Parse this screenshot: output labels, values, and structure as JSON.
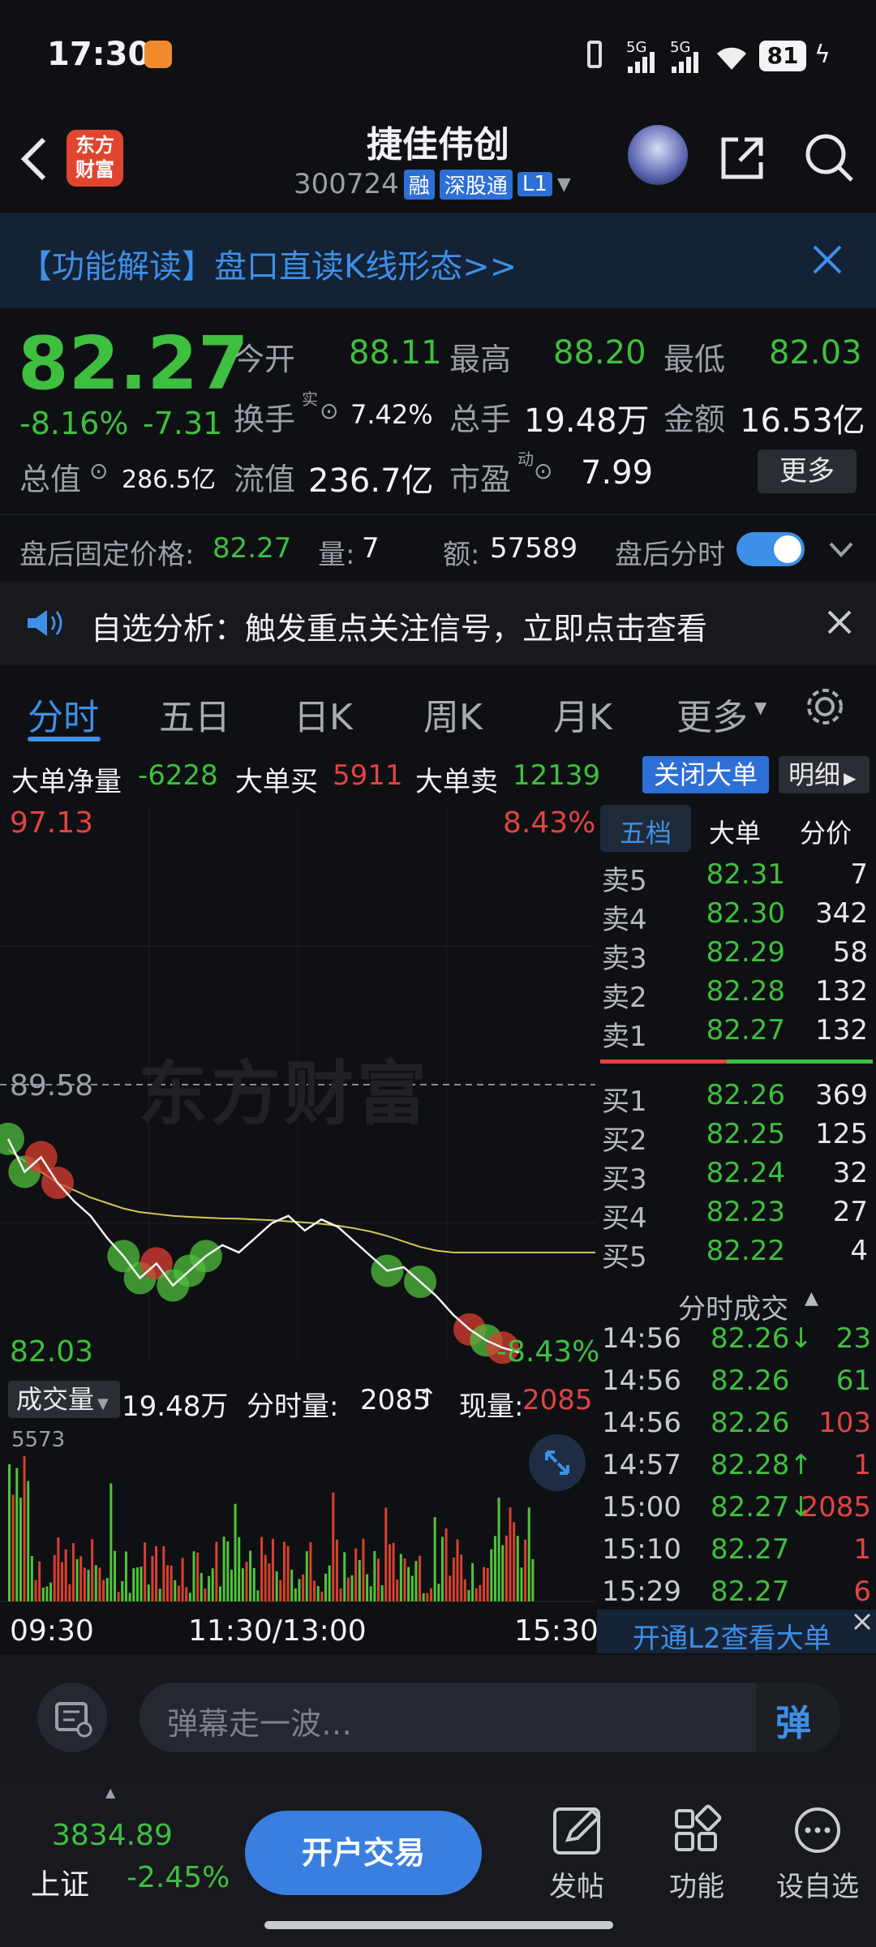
{
  "status": {
    "time": "17:30",
    "battery": "81",
    "network1": "5G",
    "network2": "5G"
  },
  "header": {
    "stock_name": "捷佳伟创",
    "code": "300724",
    "tags": [
      "融",
      "深股通",
      "L1"
    ],
    "logo_text": "东方财富"
  },
  "banner": {
    "text": "【功能解读】盘口直读K线形态>>"
  },
  "quote": {
    "price": "82.27",
    "change_pct": "-8.16%",
    "change": "-7.31",
    "open_label": "今开",
    "open": "88.11",
    "high_label": "最高",
    "high": "88.20",
    "low_label": "最低",
    "low": "82.03",
    "turnover_label": "换手",
    "turnover_sup": "实",
    "turnover": "7.42%",
    "volume_label": "总手",
    "volume": "19.48万",
    "amount_label": "金额",
    "amount": "16.53亿",
    "mktcap_label": "总值",
    "mktcap": "286.5亿",
    "float_label": "流值",
    "float_cap": "236.7亿",
    "pe_label": "市盈",
    "pe_sup": "动",
    "pe": "7.99",
    "more_label": "更多"
  },
  "after_hours": {
    "price_label": "盘后固定价格:",
    "price": "82.27",
    "vol_label": "量:",
    "vol": "7",
    "amt_label": "额:",
    "amt": "57589",
    "timeshare_label": "盘后分时",
    "toggle_on": true
  },
  "notice": {
    "text": "自选分析：触发重点关注信号，立即点击查看"
  },
  "tabs": [
    {
      "label": "分时",
      "active": true
    },
    {
      "label": "五日"
    },
    {
      "label": "日K"
    },
    {
      "label": "周K"
    },
    {
      "label": "月K"
    },
    {
      "label": "更多"
    }
  ],
  "bigorder": {
    "net_label": "大单净量",
    "net": "-6228",
    "buy_label": "大单买",
    "buy": "5911",
    "sell_label": "大单卖",
    "sell": "12139",
    "close_btn": "关闭大单",
    "detail_btn": "明细"
  },
  "chart": {
    "top_price": "97.13",
    "top_pct": "8.43%",
    "prev_close": "89.58",
    "bottom_price": "82.03",
    "bottom_pct": "-8.43%",
    "watermark": "东方财富",
    "volume_label": "成交量",
    "volume_total": "19.48万",
    "timeshare_vol_label": "分时量:",
    "timeshare_vol": "2085",
    "current_vol_label": "现量:",
    "current_vol": "2085",
    "vol_max": "5573",
    "x_labels": [
      "09:30",
      "11:30/13:00",
      "15:30"
    ]
  },
  "chart_data": {
    "type": "line",
    "ylim": [
      82.03,
      97.13
    ],
    "prev_close": 89.58,
    "series": [],
    "price_points": [
      88.1,
      87.2,
      87.6,
      86.9,
      86.4,
      86.0,
      85.4,
      84.9,
      84.3,
      84.7,
      84.1,
      84.5,
      84.9,
      85.2,
      85.0,
      85.4,
      85.8,
      86.0,
      85.6,
      85.9,
      85.7,
      85.3,
      84.9,
      84.5,
      84.6,
      84.2,
      83.8,
      83.3,
      82.9,
      82.6,
      82.4,
      82.27
    ],
    "avg_points": [
      87.8,
      87.5,
      87.2,
      86.9,
      86.7,
      86.5,
      86.35,
      86.2,
      86.1,
      86.05,
      86.0,
      85.97,
      85.95,
      85.93,
      85.92,
      85.9,
      85.88,
      85.85,
      85.82,
      85.78,
      85.73,
      85.66,
      85.57,
      85.45,
      85.3,
      85.15,
      85.05,
      85.0,
      85.0,
      85.0,
      85.0,
      85.0
    ],
    "volume_max": 5573
  },
  "orderbook": {
    "tabs": [
      "五档",
      "大单",
      "分价"
    ],
    "asks": [
      {
        "label": "卖5",
        "price": "82.31",
        "vol": "7"
      },
      {
        "label": "卖4",
        "price": "82.30",
        "vol": "342"
      },
      {
        "label": "卖3",
        "price": "82.29",
        "vol": "58"
      },
      {
        "label": "卖2",
        "price": "82.28",
        "vol": "132"
      },
      {
        "label": "卖1",
        "price": "82.27",
        "vol": "132"
      }
    ],
    "bids": [
      {
        "label": "买1",
        "price": "82.26",
        "vol": "369"
      },
      {
        "label": "买2",
        "price": "82.25",
        "vol": "125"
      },
      {
        "label": "买3",
        "price": "82.24",
        "vol": "32"
      },
      {
        "label": "买4",
        "price": "82.23",
        "vol": "27"
      },
      {
        "label": "买5",
        "price": "82.22",
        "vol": "4"
      }
    ],
    "ticks_title": "分时成交",
    "ticks": [
      {
        "time": "14:56",
        "price": "82.26↓",
        "vol": "23",
        "vol_color": "green"
      },
      {
        "time": "14:56",
        "price": "82.26",
        "vol": "61",
        "vol_color": "green"
      },
      {
        "time": "14:56",
        "price": "82.26",
        "vol": "103",
        "vol_color": "red"
      },
      {
        "time": "14:57",
        "price": "82.28↑",
        "vol": "1",
        "vol_color": "red"
      },
      {
        "time": "15:00",
        "price": "82.27↓",
        "vol": "2085",
        "vol_color": "red"
      },
      {
        "time": "15:10",
        "price": "82.27",
        "vol": "1",
        "vol_color": "red"
      },
      {
        "time": "15:29",
        "price": "82.27",
        "vol": "6",
        "vol_color": "red"
      }
    ],
    "l2_text": "开通L2查看大单"
  },
  "danmaku": {
    "placeholder": "弹幕走一波…",
    "btn": "弹"
  },
  "bottom": {
    "index_value": "3834.89",
    "index_name": "上证",
    "index_change": "-2.45%",
    "trade_btn": "开户交易",
    "nav": [
      {
        "label": "发帖",
        "icon": "edit-icon"
      },
      {
        "label": "功能",
        "icon": "grid-icon"
      },
      {
        "label": "设自选",
        "icon": "more-icon"
      }
    ]
  }
}
